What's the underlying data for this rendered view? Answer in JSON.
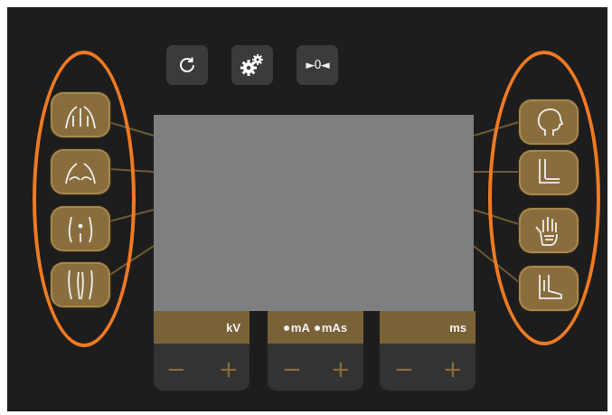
{
  "top_buttons": [
    {
      "icon": "refresh-icon"
    },
    {
      "icon": "gear-icon"
    },
    {
      "icon": "zero-calibrate-icon",
      "label": "►0◄"
    }
  ],
  "left_presets": [
    {
      "icon": "upper-back-icon"
    },
    {
      "icon": "chest-icon"
    },
    {
      "icon": "pelvis-icon"
    },
    {
      "icon": "legs-icon"
    }
  ],
  "right_presets": [
    {
      "icon": "head-icon"
    },
    {
      "icon": "elbow-icon"
    },
    {
      "icon": "hand-icon"
    },
    {
      "icon": "foot-icon"
    }
  ],
  "controls": {
    "kv": {
      "label": "kV",
      "minus": "−",
      "plus": "+"
    },
    "current": {
      "ma_label": "mA",
      "mas_label": "mAs",
      "minus": "−",
      "plus": "+"
    },
    "time": {
      "label": "ms",
      "minus": "−",
      "plus": "+"
    }
  },
  "colors": {
    "panel": "#1d1d1d",
    "screen": "#7d7f81",
    "preset_gold": "#8a6d3c",
    "highlight_ring": "#f07a22"
  }
}
